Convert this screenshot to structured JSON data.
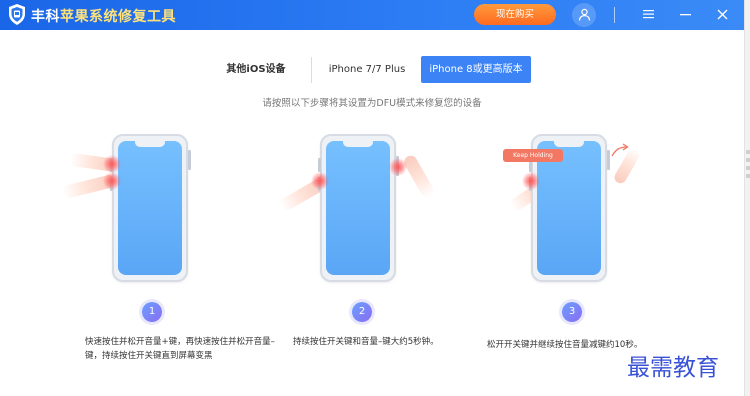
{
  "app": {
    "title_brand": "丰科",
    "title_product": "苹果系统修复工具",
    "buy_label": "现在购买"
  },
  "tabs": [
    {
      "label": "其他iOS设备",
      "active": false
    },
    {
      "label": "iPhone 7/7 Plus",
      "active": false
    },
    {
      "label": "iPhone 8或更高版本",
      "active": true
    }
  ],
  "instruction": "请按照以下步骤将其设置为DFU模式来修复您的设备",
  "phone3_bubble": "Keep Holding",
  "steps": [
    {
      "num": "1",
      "text": "快速按住并松开音量+键，再快速按住并松开音量– 键，持续按住开关键直到屏幕变黑"
    },
    {
      "num": "2",
      "text": "持续按住开关键和音量–键大约5秒钟。"
    },
    {
      "num": "3",
      "text": "松开开关键并继续按住音量减键约10秒。"
    }
  ],
  "watermark": "最需教育",
  "colors": {
    "titlebar": "#2c7cf4",
    "brand_accent": "#ffe27a",
    "buy_button": "#ff7a26",
    "active_tab": "#3c83f6",
    "phone_screen": "#6ab4fb",
    "press_glow": "#ff5a5a",
    "keep_holding": "#f27863",
    "step_badge": "#7a86f4",
    "watermark": "#3a52d6"
  }
}
